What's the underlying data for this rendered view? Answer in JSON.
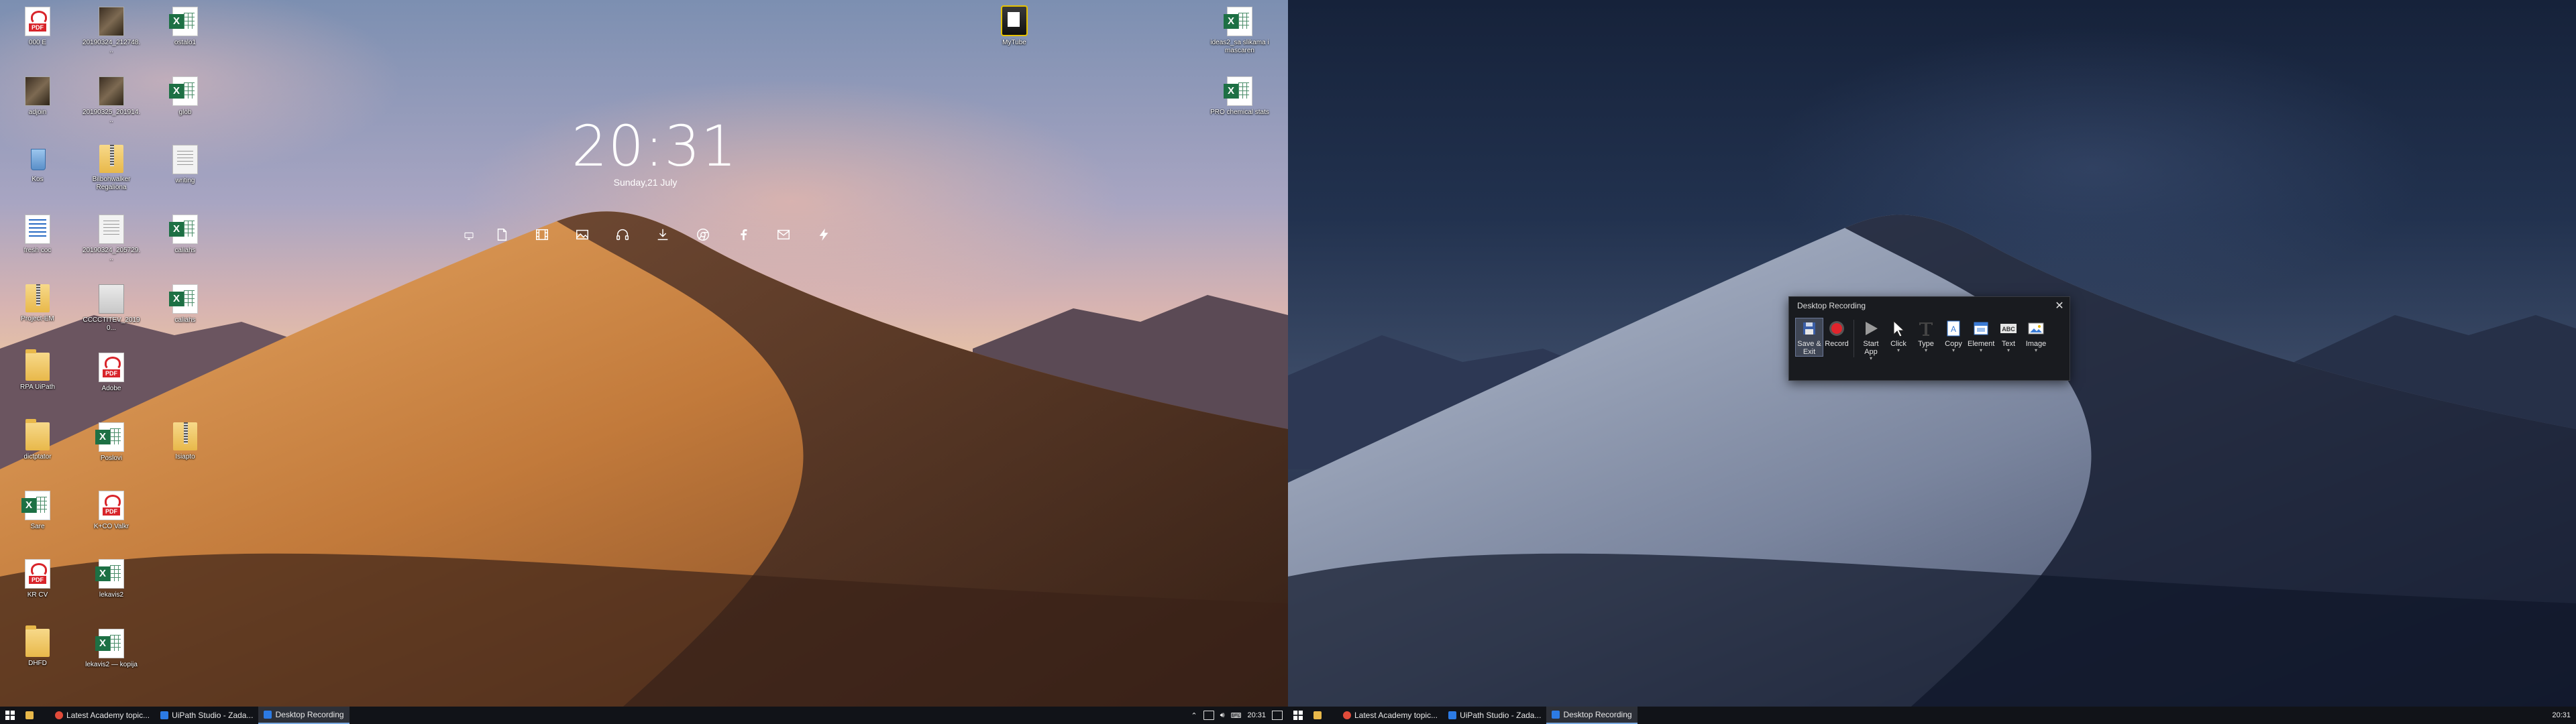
{
  "left_monitor": {
    "desktop_icons": [
      {
        "label": "000 E",
        "type": "pdf"
      },
      {
        "label": "20190324_212748...",
        "type": "image"
      },
      {
        "label": "ostalo1",
        "type": "excel"
      },
      {
        "label": "adjoin",
        "type": "image"
      },
      {
        "label": "20190325_201914...",
        "type": "image"
      },
      {
        "label": "glob",
        "type": "excel"
      },
      {
        "label": "Kos",
        "type": "recycle"
      },
      {
        "label": "Bilbohwalker Regaliona",
        "type": "folder-zip"
      },
      {
        "label": "writing",
        "type": "document"
      },
      {
        "label": "fresh coc",
        "type": "text"
      },
      {
        "label": "20190324_205729...",
        "type": "document"
      },
      {
        "label": "caliahs",
        "type": "excel"
      },
      {
        "label": "Project-EM",
        "type": "folder-zip"
      },
      {
        "label": "CCCCTITEV_20190...",
        "type": "drive"
      },
      {
        "label": "caliahs",
        "type": "excel"
      },
      {
        "label": "RPA UiPath",
        "type": "folder"
      },
      {
        "label": "Adobe",
        "type": "pdf"
      },
      {
        "label": "dictptator",
        "type": "folder"
      },
      {
        "label": "Poslovi",
        "type": "excel"
      },
      {
        "label": "Isiapto",
        "type": "folder"
      },
      {
        "label": "Sare",
        "type": "excel"
      },
      {
        "label": "K+CO Valkr",
        "type": "pdf"
      },
      {
        "label": "KR CV",
        "type": "pdf"
      },
      {
        "label": "lekavis2",
        "type": "excel"
      },
      {
        "label": "DHFD",
        "type": "folder"
      },
      {
        "label": "lekavis2 — kopija",
        "type": "excel"
      },
      {
        "label": "MyTube",
        "type": "app"
      }
    ],
    "right_icons": [
      {
        "label": "ideas2_sa slikama i mascaren",
        "type": "excel"
      },
      {
        "label": "PRO chemical stats",
        "type": "excel"
      }
    ],
    "clock": {
      "time": "20:31",
      "date": "Sunday,21 July"
    },
    "dock_icons": [
      "monitor-icon",
      "document-icon",
      "film-icon",
      "image-icon",
      "headphones-icon",
      "download-icon",
      "chrome-icon",
      "facebook-icon",
      "mail-icon",
      "bolt-icon"
    ],
    "taskbar": {
      "windows": [
        {
          "label": "Latest Academy topic...",
          "color": "#e14b3a",
          "active": false
        },
        {
          "label": "UiPath Studio - Zada...",
          "color": "#2c7be5",
          "active": false
        },
        {
          "label": "Desktop Recording",
          "color": "#2c7be5",
          "active": true
        }
      ],
      "tray_time": "20:31"
    }
  },
  "right_monitor": {
    "taskbar": {
      "windows": [
        {
          "label": "Latest Academy topic...",
          "color": "#e14b3a",
          "active": false
        },
        {
          "label": "UiPath Studio - Zada...",
          "color": "#2c7be5",
          "active": false
        },
        {
          "label": "Desktop Recording",
          "color": "#2c7be5",
          "active": true
        }
      ],
      "tray_time": "20:31"
    },
    "recording_panel": {
      "title": "Desktop Recording",
      "tools": [
        {
          "label": "Save & Exit",
          "icon": "save-icon",
          "selected": true,
          "dropdown": false
        },
        {
          "label": "Record",
          "icon": "record-icon",
          "selected": false,
          "dropdown": false
        },
        {
          "label": "Start App",
          "icon": "play-icon",
          "selected": false,
          "dropdown": true
        },
        {
          "label": "Click",
          "icon": "cursor-icon",
          "selected": false,
          "dropdown": true
        },
        {
          "label": "Type",
          "icon": "type-icon",
          "selected": false,
          "dropdown": true
        },
        {
          "label": "Copy",
          "icon": "copy-icon",
          "selected": false,
          "dropdown": true
        },
        {
          "label": "Element",
          "icon": "element-icon",
          "selected": false,
          "dropdown": true
        },
        {
          "label": "Text",
          "icon": "text-icon",
          "selected": false,
          "dropdown": true
        },
        {
          "label": "Image",
          "icon": "image-icon",
          "selected": false,
          "dropdown": true
        }
      ]
    }
  },
  "colors": {
    "taskbar": "#111318",
    "record_red": "#e0242c",
    "excel_green": "#1d7044",
    "pdf_red": "#d8242a"
  }
}
